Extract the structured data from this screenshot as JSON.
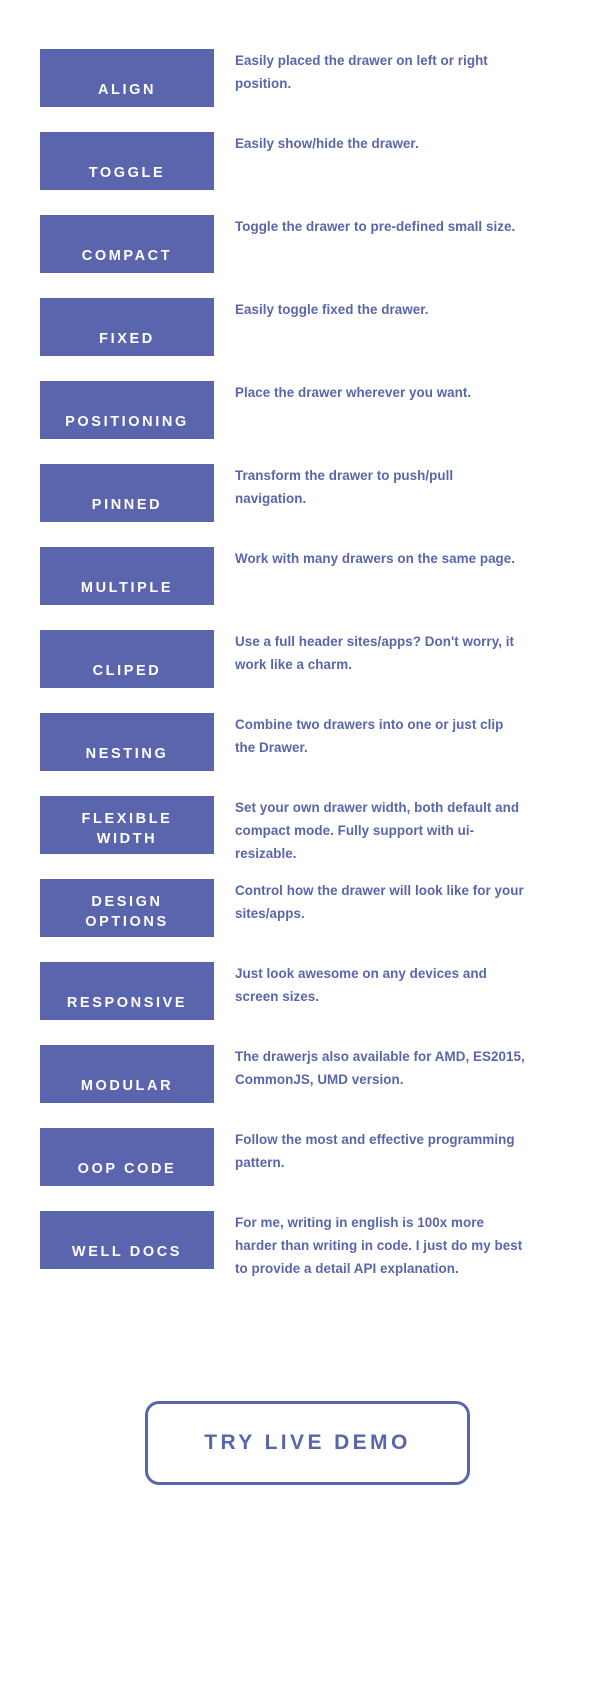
{
  "theme": {
    "badge_background": "#5b65ae",
    "badge_text": "#ffffff",
    "description_text": "#5a66ab",
    "page_background": "#ffffff",
    "cta_border": "#5b65ae"
  },
  "features": [
    {
      "label": "ALIGN",
      "description": "Easily placed the drawer on left or right position."
    },
    {
      "label": "TOGGLE",
      "description": "Easily show/hide the drawer."
    },
    {
      "label": "COMPACT",
      "description": "Toggle the drawer to pre-defined small size."
    },
    {
      "label": "FIXED",
      "description": "Easily toggle fixed the drawer."
    },
    {
      "label": "POSITIONING",
      "description": "Place the drawer wherever you want."
    },
    {
      "label": "PINNED",
      "description": "Transform the drawer to push/pull navigation."
    },
    {
      "label": "MULTIPLE",
      "description": "Work with many drawers on the same page."
    },
    {
      "label": "CLIPED",
      "description": "Use a full header sites/apps? Don't worry, it work like a charm."
    },
    {
      "label": "NESTING",
      "description": "Combine two drawers into one or just clip the Drawer."
    },
    {
      "label": "FLEXIBLE\nWIDTH",
      "description": "Set your own drawer width, both default and compact mode. Fully support with ui-resizable."
    },
    {
      "label": "DESIGN\nOPTIONS",
      "description": "Control how the drawer will look like for your sites/apps."
    },
    {
      "label": "RESPONSIVE",
      "description": "Just look awesome on any devices and screen sizes."
    },
    {
      "label": "MODULAR",
      "description": "The drawerjs also available for AMD, ES2015, CommonJS, UMD version."
    },
    {
      "label": "OOP CODE",
      "description": "Follow the most and effective programming pattern."
    },
    {
      "label": "WELL DOCS",
      "description": "For me, writing in english is 100x more harder than writing in code. I just do my best to provide a detail API explanation."
    }
  ],
  "cta": {
    "label": "TRY LIVE DEMO"
  }
}
